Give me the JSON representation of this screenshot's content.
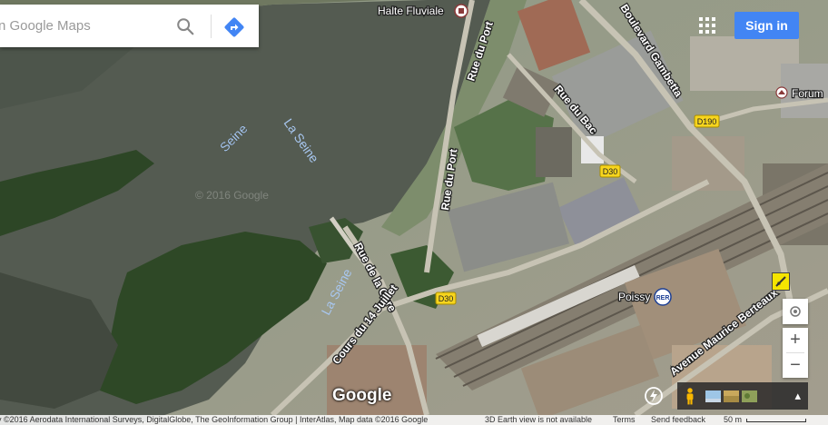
{
  "search": {
    "placeholder": "n Google Maps"
  },
  "header": {
    "signin_label": "Sign in"
  },
  "map": {
    "places": {
      "halte": "Halte Fluviale",
      "forum": "Forum",
      "poissy": "Poissy",
      "rer": "RER"
    },
    "water": {
      "seine1": "Seine",
      "seine2": "La Seine",
      "seine3": "La Seine"
    },
    "streets": {
      "rue_du_port_top": "Rue du Port",
      "rue_du_port_mid": "Rue du Port",
      "boulevard_gambetta": "Boulevard Gambetta",
      "rue_du_bac": "Rue du Bac",
      "rue_de_la_gare": "Rue de la Gare",
      "cours_14_juillet": "Cours du 14 Juillet",
      "avenue_maurice": "Avenue Maurice Berteaux"
    },
    "shields": {
      "d190": "D190",
      "d30a": "D30",
      "d30b": "D30"
    },
    "watermark": "© 2016 Google"
  },
  "controls": {
    "zoom_in": "+",
    "zoom_out": "−"
  },
  "footer": {
    "credits": "ry ©2016 Aerodata International Surveys, DigitalGlobe, The GeoInformation Group | InterAtlas, Map data ©2016 Google",
    "earth_note": "3D Earth view is not available",
    "terms": "Terms",
    "feedback": "Send feedback",
    "scale": "50 m"
  },
  "logo": "Google",
  "colors": {
    "accent": "#4285f4",
    "water": "#5a6258",
    "vegetation": "#2f4a26",
    "shield": "#f7d51d"
  }
}
